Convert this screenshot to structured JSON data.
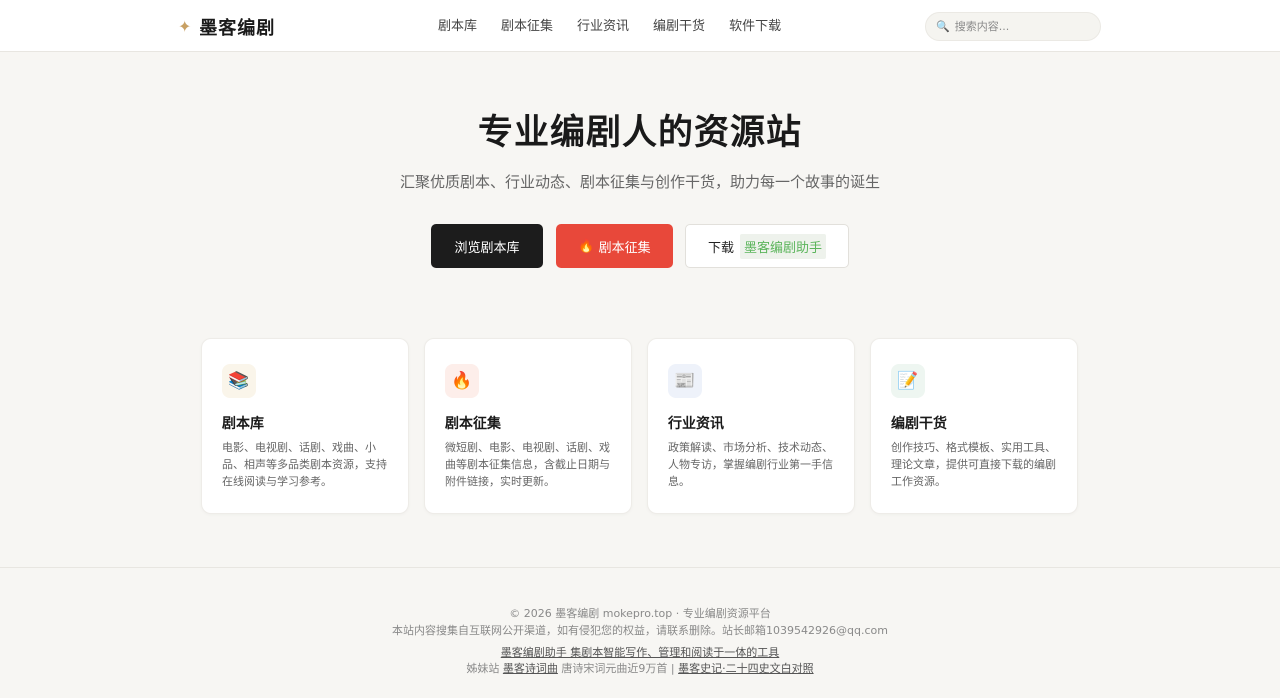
{
  "header": {
    "brand_icon": "✦",
    "brand_name": "墨客编剧",
    "nav": [
      "剧本库",
      "剧本征集",
      "行业资讯",
      "编剧干货",
      "软件下载"
    ],
    "search_placeholder": "搜索内容..."
  },
  "hero": {
    "title": "专业编剧人的资源站",
    "subtitle": "汇聚优质剧本、行业动态、剧本征集与创作干货，助力每一个故事的诞生",
    "btn_browse": "浏览剧本库",
    "btn_contest_icon": "🔥",
    "btn_contest": "剧本征集",
    "btn_download_prefix": "下载",
    "btn_download_highlight": "墨客编剧助手"
  },
  "cards": [
    {
      "icon": "📚",
      "title": "剧本库",
      "desc": "电影、电视剧、话剧、戏曲、小品、相声等多品类剧本资源，支持在线阅读与学习参考。"
    },
    {
      "icon": "🔥",
      "title": "剧本征集",
      "desc": "微短剧、电影、电视剧、话剧、戏曲等剧本征集信息，含截止日期与附件链接，实时更新。"
    },
    {
      "icon": "📰",
      "title": "行业资讯",
      "desc": "政策解读、市场分析、技术动态、人物专访，掌握编剧行业第一手信息。"
    },
    {
      "icon": "📝",
      "title": "编剧干货",
      "desc": "创作技巧、格式模板、实用工具、理论文章，提供可直接下载的编剧工作资源。"
    }
  ],
  "colors": {
    "accent_dark": "#1c1c1c",
    "accent_red": "#e8483a",
    "brand_gold": "#c8a063",
    "highlight_green": "#5cb55c"
  },
  "footer": {
    "copyright": "© 2026 墨客编剧 mokepro.top · 专业编剧资源平台",
    "disclaimer": "本站内容搜集自互联网公开渠道，如有侵犯您的权益，请联系删除。站长邮箱1039542926@qq.com",
    "promo_link": "墨客编剧助手 集剧本智能写作、管理和阅读于一体的工具",
    "sister_label": "姊妹站",
    "sister_link1": "墨客诗词曲",
    "sister_text": "唐诗宋词元曲近9万首 |",
    "sister_link2": "墨客史记·二十四史文白对照"
  }
}
